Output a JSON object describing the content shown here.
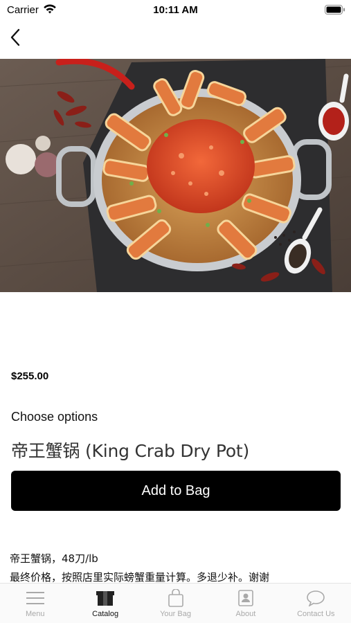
{
  "status_bar": {
    "carrier": "Carrier",
    "time": "10:11 AM"
  },
  "icons": {
    "back": "chevron-left-icon",
    "wifi": "wifi-icon",
    "battery": "battery-icon"
  },
  "product": {
    "price": "$255.00",
    "options_label": "Choose options",
    "title": "帝王蟹锅 (King Crab Dry Pot)",
    "add_to_bag": "Add to Bag",
    "description_lines": [
      "帝王蟹锅，48刀/lb",
      "最终价格，按照店里实际螃蟹重量计算。多退少补。谢谢"
    ]
  },
  "tab_bar": {
    "active_tab": "Catalog",
    "inactive_color": "#a9a9a9",
    "active_color": "#111111",
    "items": [
      {
        "label": "Menu",
        "icon": "menu-icon"
      },
      {
        "label": "Catalog",
        "icon": "box-icon"
      },
      {
        "label": "Your Bag",
        "icon": "bag-icon"
      },
      {
        "label": "About",
        "icon": "contact-card-icon"
      },
      {
        "label": "Contact Us",
        "icon": "chat-bubble-icon"
      }
    ]
  },
  "colors": {
    "button_bg": "#000000",
    "button_text": "#ffffff"
  }
}
